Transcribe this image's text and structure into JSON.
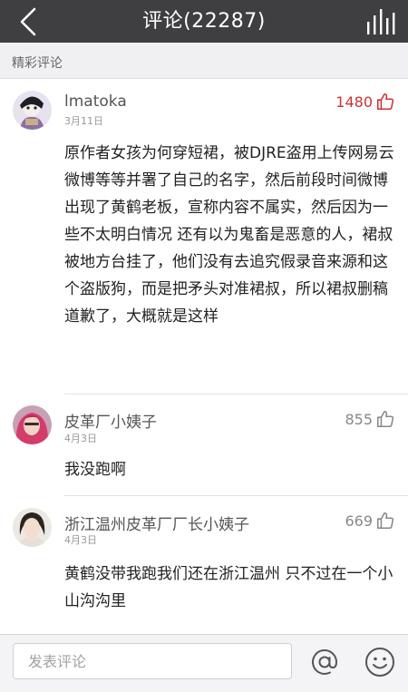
{
  "header": {
    "title": "评论(22287)",
    "back_icon": "chevron-left-icon",
    "stats_icon": "bar-stats-icon"
  },
  "section": {
    "label": "精彩评论"
  },
  "comments": [
    {
      "username": "lmatoka",
      "date": "3月11日",
      "likes": "1480",
      "liked": true,
      "text": "原作者女孩为何穿短裙，被DJRE盗用上传网易云 微博等等并署了自己的名字，然后前段时间微博出现了黄鹤老板，宣称内容不属实，然后因为一些不太明白情况 还有以为鬼畜是恶意的人，裙叔被地方台挂了，他们没有去追究假录音来源和这个盗版狗，而是把矛头对准裙叔，所以裙叔删稿道歉了，大概就是这样"
    },
    {
      "username": "皮革厂小姨子",
      "date": "4月3日",
      "likes": "855",
      "liked": false,
      "text": "我没跑啊"
    },
    {
      "username": "浙江温州皮革厂厂长小姨子",
      "date": "4月3日",
      "likes": "669",
      "liked": false,
      "text": "黄鹤没带我跑我们还在浙江温州 只不过在一个小山沟沟里"
    }
  ],
  "footer": {
    "placeholder": "发表评论",
    "at_icon": "at-icon",
    "emoji_icon": "smiley-icon"
  },
  "colors": {
    "topbar": "#3f3f42",
    "hot_like": "#cc3333",
    "section_bg": "#f0f0f2"
  }
}
